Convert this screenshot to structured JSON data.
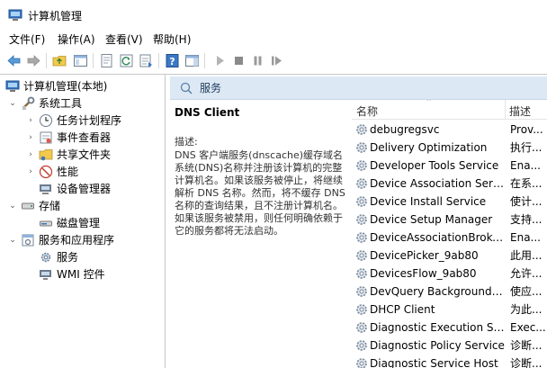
{
  "window": {
    "title": "计算机管理",
    "accent": "#dce9f5"
  },
  "menu": [
    "文件(F)",
    "操作(A)",
    "查看(V)",
    "帮助(H)"
  ],
  "tree": [
    {
      "label": "计算机管理(本地)",
      "icon": "computer-management-icon",
      "expanded": true
    },
    {
      "label": "系统工具",
      "icon": "system-tools-icon",
      "expanded": true
    },
    {
      "label": "任务计划程序",
      "icon": "task-scheduler-icon",
      "expanded": false
    },
    {
      "label": "事件查看器",
      "icon": "event-viewer-icon",
      "expanded": false
    },
    {
      "label": "共享文件夹",
      "icon": "shared-folders-icon",
      "expanded": false
    },
    {
      "label": "性能",
      "icon": "performance-icon",
      "expanded": false
    },
    {
      "label": "设备管理器",
      "icon": "device-manager-icon",
      "expanded": null
    },
    {
      "label": "存储",
      "icon": "storage-icon",
      "expanded": true
    },
    {
      "label": "磁盘管理",
      "icon": "disk-management-icon",
      "expanded": null
    },
    {
      "label": "服务和应用程序",
      "icon": "services-applications-icon",
      "expanded": true
    },
    {
      "label": "服务",
      "icon": "services-gear-icon",
      "expanded": null
    },
    {
      "label": "WMI 控件",
      "icon": "wmi-control-icon",
      "expanded": null
    }
  ],
  "pane": {
    "title": "服务",
    "selected_service": "DNS Client",
    "description_label": "描述:",
    "description": "DNS 客户端服务(dnscache)缓存域名系统(DNS)名称并注册该计算机的完整计算机名。如果该服务被停止，将继续解析 DNS 名称。然而，将不缓存 DNS 名称的查询结果，且不注册计算机名。如果该服务被禁用，则任何明确依赖于它的服务都将无法启动。"
  },
  "list": {
    "columns": {
      "name": "名称",
      "description": "描述"
    },
    "rows": [
      {
        "name": "debugregsvc",
        "desc": "Prov..."
      },
      {
        "name": "Delivery Optimization",
        "desc": "执行..."
      },
      {
        "name": "Developer Tools Service",
        "desc": "Ena..."
      },
      {
        "name": "Device Association Service",
        "desc": "在系..."
      },
      {
        "name": "Device Install Service",
        "desc": "使计..."
      },
      {
        "name": "Device Setup Manager",
        "desc": "支持..."
      },
      {
        "name": "DeviceAssociationBroker...",
        "desc": "Ena..."
      },
      {
        "name": "DevicePicker_9ab80",
        "desc": "此用..."
      },
      {
        "name": "DevicesFlow_9ab80",
        "desc": "允许..."
      },
      {
        "name": "DevQuery Background D...",
        "desc": "使应..."
      },
      {
        "name": "DHCP Client",
        "desc": "为此..."
      },
      {
        "name": "Diagnostic Execution Ser...",
        "desc": "Exec..."
      },
      {
        "name": "Diagnostic Policy Service",
        "desc": "诊断..."
      },
      {
        "name": "Diagnostic Service Host",
        "desc": "诊断..."
      }
    ]
  }
}
